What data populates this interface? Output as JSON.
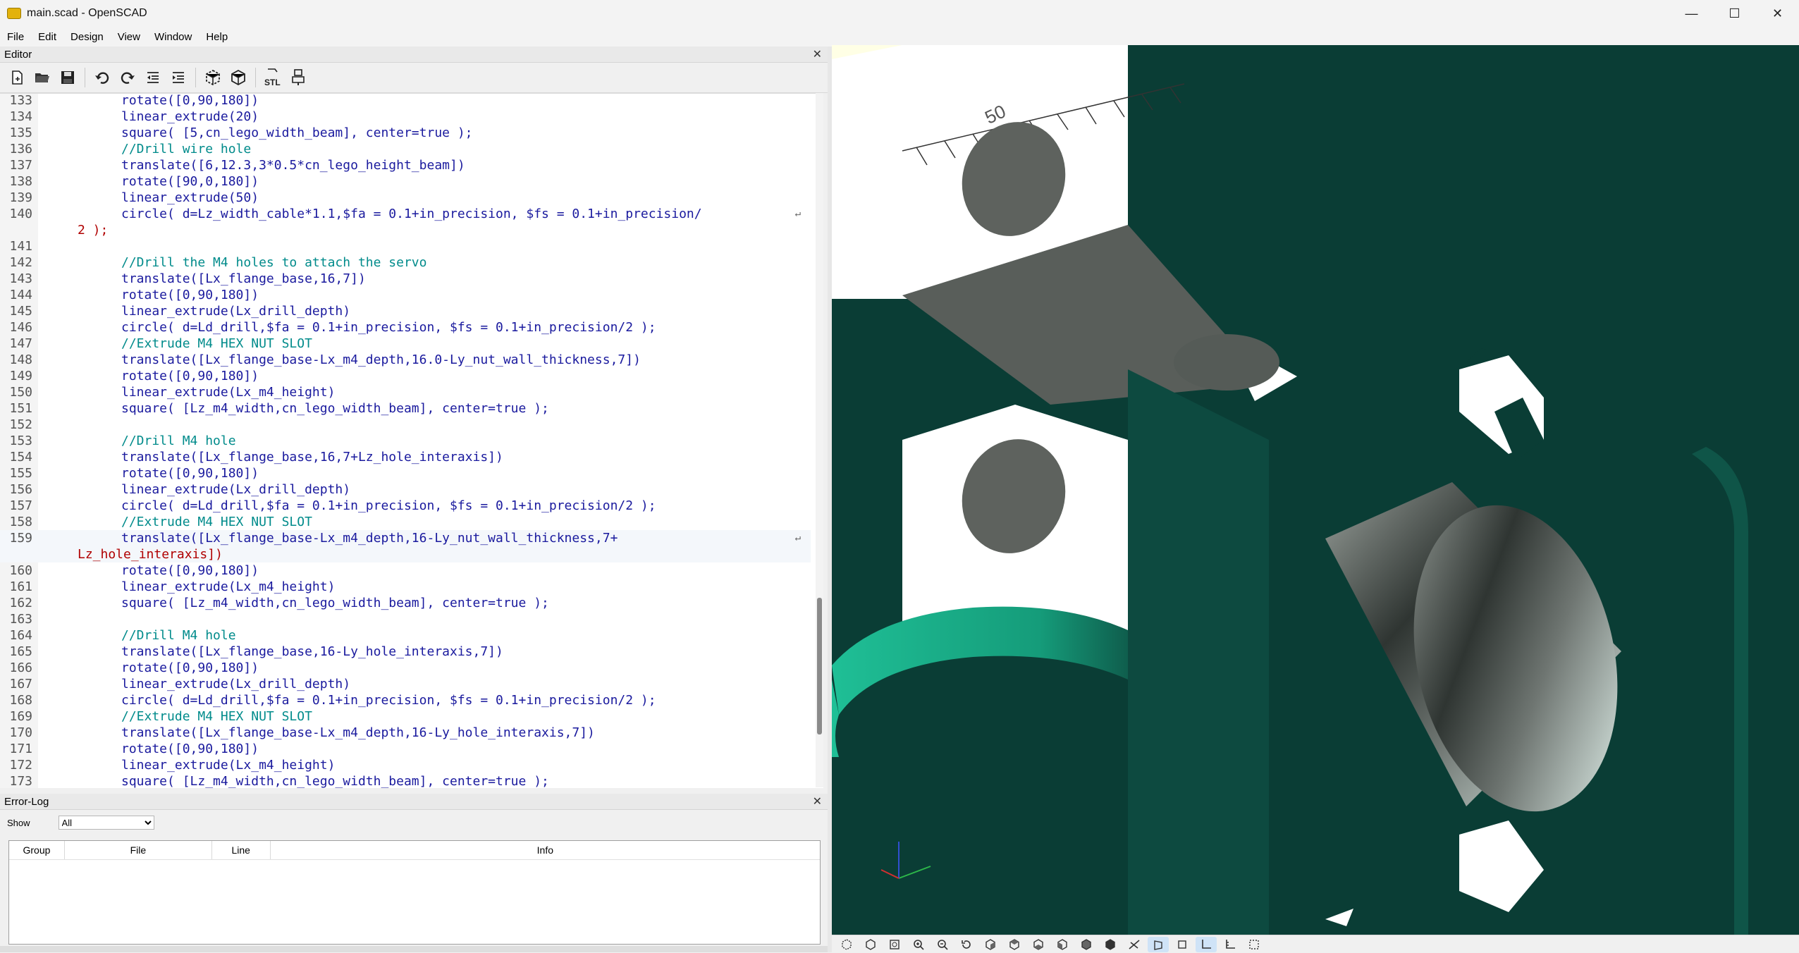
{
  "window": {
    "title": "main.scad - OpenSCAD",
    "minimize": "—",
    "maximize": "☐",
    "close": "✕"
  },
  "menu": [
    "File",
    "Edit",
    "Design",
    "View",
    "Window",
    "Help"
  ],
  "editor": {
    "title": "Editor",
    "close": "✕",
    "toolbar_icons": [
      "new-file-icon",
      "open-file-icon",
      "save-icon",
      "undo-icon",
      "redo-icon",
      "unindent-icon",
      "indent-icon",
      "preview-icon",
      "render-icon",
      "export-stl-icon",
      "send-to-print-icon"
    ],
    "stl_label": "STL",
    "lines": [
      {
        "n": "133",
        "indent": 10,
        "t": "rotate([0,90,180])"
      },
      {
        "n": "134",
        "indent": 10,
        "t": "linear_extrude(20)"
      },
      {
        "n": "135",
        "indent": 10,
        "t": "square( [5,cn_lego_width_beam], center=true );"
      },
      {
        "n": "136",
        "indent": 10,
        "t": "//Drill wire hole"
      },
      {
        "n": "137",
        "indent": 10,
        "t": "translate([6,12.3,3*0.5*cn_lego_height_beam])"
      },
      {
        "n": "138",
        "indent": 10,
        "t": "rotate([90,0,180])"
      },
      {
        "n": "139",
        "indent": 10,
        "t": "linear_extrude(50)"
      },
      {
        "n": "140",
        "indent": 10,
        "t": "circle( d=Lz_width_cable*1.1,$fa = 0.1+in_precision, $fs = 0.1+in_precision/"
      },
      {
        "n": "",
        "indent": 0,
        "t": "2 );"
      },
      {
        "n": "141",
        "indent": 0,
        "t": ""
      },
      {
        "n": "142",
        "indent": 10,
        "t": "//Drill the M4 holes to attach the servo"
      },
      {
        "n": "143",
        "indent": 10,
        "t": "translate([Lx_flange_base,16,7])"
      },
      {
        "n": "144",
        "indent": 10,
        "t": "rotate([0,90,180])"
      },
      {
        "n": "145",
        "indent": 10,
        "t": "linear_extrude(Lx_drill_depth)"
      },
      {
        "n": "146",
        "indent": 10,
        "t": "circle( d=Ld_drill,$fa = 0.1+in_precision, $fs = 0.1+in_precision/2 );"
      },
      {
        "n": "147",
        "indent": 10,
        "t": "//Extrude M4 HEX NUT SLOT"
      },
      {
        "n": "148",
        "indent": 10,
        "t": "translate([Lx_flange_base-Lx_m4_depth,16.0-Ly_nut_wall_thickness,7])"
      },
      {
        "n": "149",
        "indent": 10,
        "t": "rotate([0,90,180])"
      },
      {
        "n": "150",
        "indent": 10,
        "t": "linear_extrude(Lx_m4_height)"
      },
      {
        "n": "151",
        "indent": 10,
        "t": "square( [Lz_m4_width,cn_lego_width_beam], center=true );"
      },
      {
        "n": "152",
        "indent": 0,
        "t": ""
      },
      {
        "n": "153",
        "indent": 10,
        "t": "//Drill M4 hole"
      },
      {
        "n": "154",
        "indent": 10,
        "t": "translate([Lx_flange_base,16,7+Lz_hole_interaxis])"
      },
      {
        "n": "155",
        "indent": 10,
        "t": "rotate([0,90,180])"
      },
      {
        "n": "156",
        "indent": 10,
        "t": "linear_extrude(Lx_drill_depth)"
      },
      {
        "n": "157",
        "indent": 10,
        "t": "circle( d=Ld_drill,$fa = 0.1+in_precision, $fs = 0.1+in_precision/2 );"
      },
      {
        "n": "158",
        "indent": 10,
        "t": "//Extrude M4 HEX NUT SLOT"
      },
      {
        "n": "159",
        "indent": 10,
        "t": "translate([Lx_flange_base-Lx_m4_depth,16-Ly_nut_wall_thickness,7+"
      },
      {
        "n": "",
        "indent": 0,
        "t": "Lz_hole_interaxis])"
      },
      {
        "n": "160",
        "indent": 10,
        "t": "rotate([0,90,180])"
      },
      {
        "n": "161",
        "indent": 10,
        "t": "linear_extrude(Lx_m4_height)"
      },
      {
        "n": "162",
        "indent": 10,
        "t": "square( [Lz_m4_width,cn_lego_width_beam], center=true );"
      },
      {
        "n": "163",
        "indent": 0,
        "t": ""
      },
      {
        "n": "164",
        "indent": 10,
        "t": "//Drill M4 hole"
      },
      {
        "n": "165",
        "indent": 10,
        "t": "translate([Lx_flange_base,16-Ly_hole_interaxis,7])"
      },
      {
        "n": "166",
        "indent": 10,
        "t": "rotate([0,90,180])"
      },
      {
        "n": "167",
        "indent": 10,
        "t": "linear_extrude(Lx_drill_depth)"
      },
      {
        "n": "168",
        "indent": 10,
        "t": "circle( d=Ld_drill,$fa = 0.1+in_precision, $fs = 0.1+in_precision/2 );"
      },
      {
        "n": "169",
        "indent": 10,
        "t": "//Extrude M4 HEX NUT SLOT"
      },
      {
        "n": "170",
        "indent": 10,
        "t": "translate([Lx_flange_base-Lx_m4_depth,16-Ly_hole_interaxis,7])"
      },
      {
        "n": "171",
        "indent": 10,
        "t": "rotate([0,90,180])"
      },
      {
        "n": "172",
        "indent": 10,
        "t": "linear_extrude(Lx_m4_height)"
      },
      {
        "n": "173",
        "indent": 10,
        "t": "square( [Lz_m4_width,cn_lego_width_beam], center=true );"
      }
    ]
  },
  "error_log": {
    "title": "Error-Log",
    "close": "✕",
    "show_label": "Show",
    "show_value": "All",
    "columns": [
      "Group",
      "File",
      "Line",
      "Info"
    ]
  },
  "viewport": {
    "ruler_label": "50",
    "colors": {
      "background": "#ffffe5",
      "dark_teal": "#0a3d35",
      "bright_teal": "#1fbf96",
      "gray_face": "#585d59",
      "white_face": "#ffffff"
    },
    "view_toolbar_icons": [
      "preview-view-icon",
      "render-view-icon",
      "view-all-icon",
      "zoom-in-icon",
      "zoom-out-icon",
      "reset-view-icon",
      "view-right-icon",
      "view-top-icon",
      "view-bottom-icon",
      "view-left-icon",
      "view-front-icon",
      "view-back-icon",
      "diagonal-view-icon",
      "perspective-icon",
      "orthogonal-icon",
      "show-axes-icon",
      "show-scale-icon",
      "show-edges-icon"
    ]
  }
}
